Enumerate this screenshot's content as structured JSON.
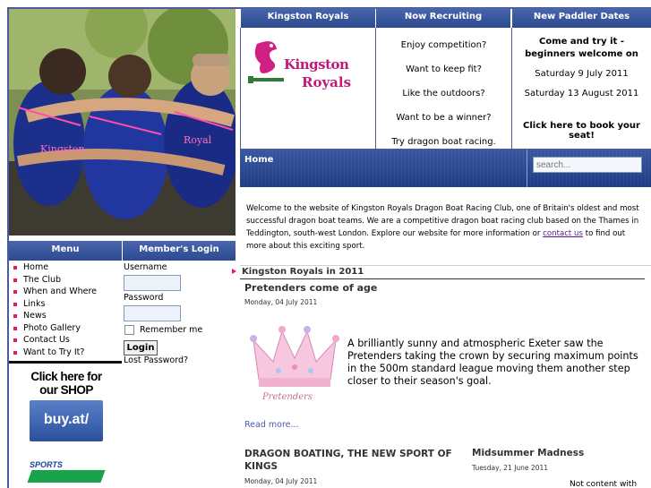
{
  "header": {
    "col1_title": "Kingston Royals",
    "col2_title": "Now Recruiting",
    "col3_title": "New Paddler Dates"
  },
  "logo": {
    "line1": "Kingston",
    "line2": "Royals"
  },
  "recruiting": {
    "lines": [
      "Enjoy competition?",
      "Want to keep fit?",
      "Like the outdoors?",
      "Want to be a winner?",
      "Try dragon boat racing."
    ]
  },
  "dates": {
    "intro_line1": "Come and try it -",
    "intro_line2": "beginners welcome on",
    "date1": "Saturday 9 July 2011",
    "date2": "Saturday 13 August 2011",
    "cta": "Click here to book your seat!"
  },
  "nav": {
    "home_label": "Home",
    "search_placeholder": "search..."
  },
  "welcome": {
    "text_before": "Welcome to the website of Kingston Royals Dragon Boat Racing Club, one of Britain's oldest and most successful dragon boat teams.  We are a competitive dragon boat racing club based on the Thames in Teddington, south-west London.  Explore our website for more information or ",
    "link": "contact us",
    "text_after": " to find out more about this exciting sport."
  },
  "menu": {
    "title": "Menu",
    "items": [
      "Home",
      "The Club",
      "When and Where",
      "Links",
      "News",
      "Photo Gallery",
      "Contact Us",
      "Want to Try It?"
    ]
  },
  "login": {
    "title": "Member's Login",
    "username_label": "Username",
    "password_label": "Password",
    "remember_label": "Remember me",
    "button_label": "Login",
    "lost_password": "Lost Password?"
  },
  "shop": {
    "line1": "Click here for",
    "line2": "our SHOP",
    "badge": "buy.at/",
    "sponsor": "SPORTS"
  },
  "section": {
    "title": "Kingston Royals in 2011"
  },
  "articles": {
    "main": {
      "title": "Pretenders come of age",
      "date": "Monday, 04 July 2011",
      "image_caption": "Pretenders",
      "body": "A brilliantly sunny and atmospheric Exeter saw the Pretenders taking the crown by securing maximum points in the 500m standard league moving them another step closer to their season's goal.",
      "read_more": "Read more..."
    },
    "left": {
      "title_line1": "DRAGON BOATING, THE NEW SPORT OF",
      "title_line2": "KINGS",
      "date": "Monday, 04 July 2011"
    },
    "right": {
      "title": "Midsummer Madness",
      "date": "Tuesday, 21 June 2011",
      "teaser": "Not content with"
    }
  },
  "colors": {
    "header_blue": "#2b4a8f",
    "border_blue": "#4c5b9e",
    "bullet_pink": "#e0177a",
    "logo_pink": "#c2187a"
  }
}
